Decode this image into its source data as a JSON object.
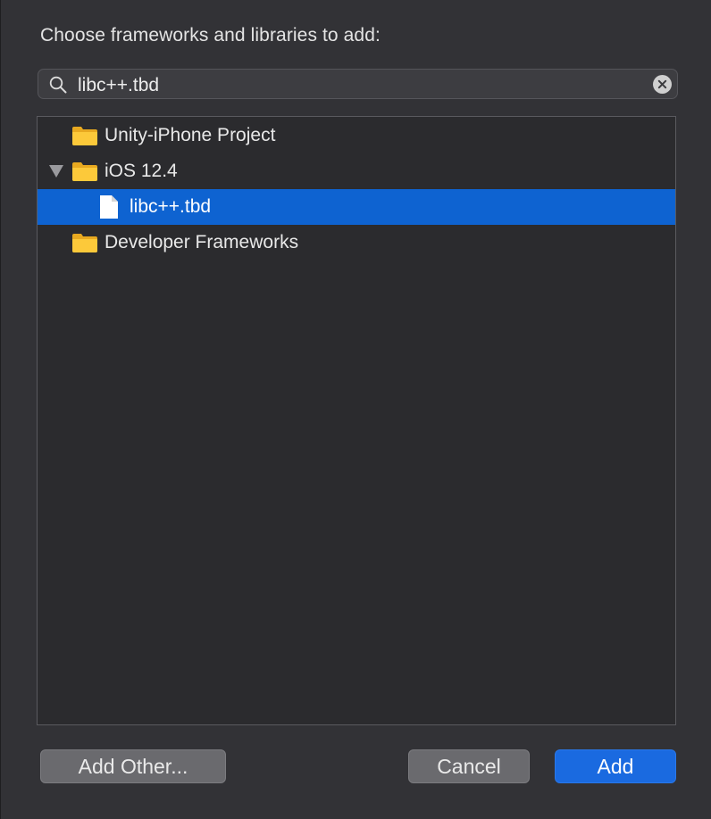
{
  "dialog": {
    "prompt": "Choose frameworks and libraries to add:"
  },
  "search": {
    "value": "libc++.tbd",
    "icon": "magnifying-glass-icon",
    "clear_icon": "clear-x-icon"
  },
  "tree": {
    "items": [
      {
        "label": "Unity-iPhone Project",
        "kind": "folder",
        "expanded": false,
        "selected": false
      },
      {
        "label": "iOS 12.4",
        "kind": "folder",
        "expanded": true,
        "selected": false
      },
      {
        "label": "libc++.tbd",
        "kind": "file",
        "selected": true
      },
      {
        "label": "Developer Frameworks",
        "kind": "folder",
        "expanded": false,
        "selected": false
      }
    ]
  },
  "buttons": {
    "add_other": "Add Other...",
    "cancel": "Cancel",
    "add": "Add"
  },
  "colors": {
    "background": "#323236",
    "selection": "#0e63d1",
    "folder": "#f7c02f",
    "primary_button": "#1a6ae0"
  }
}
